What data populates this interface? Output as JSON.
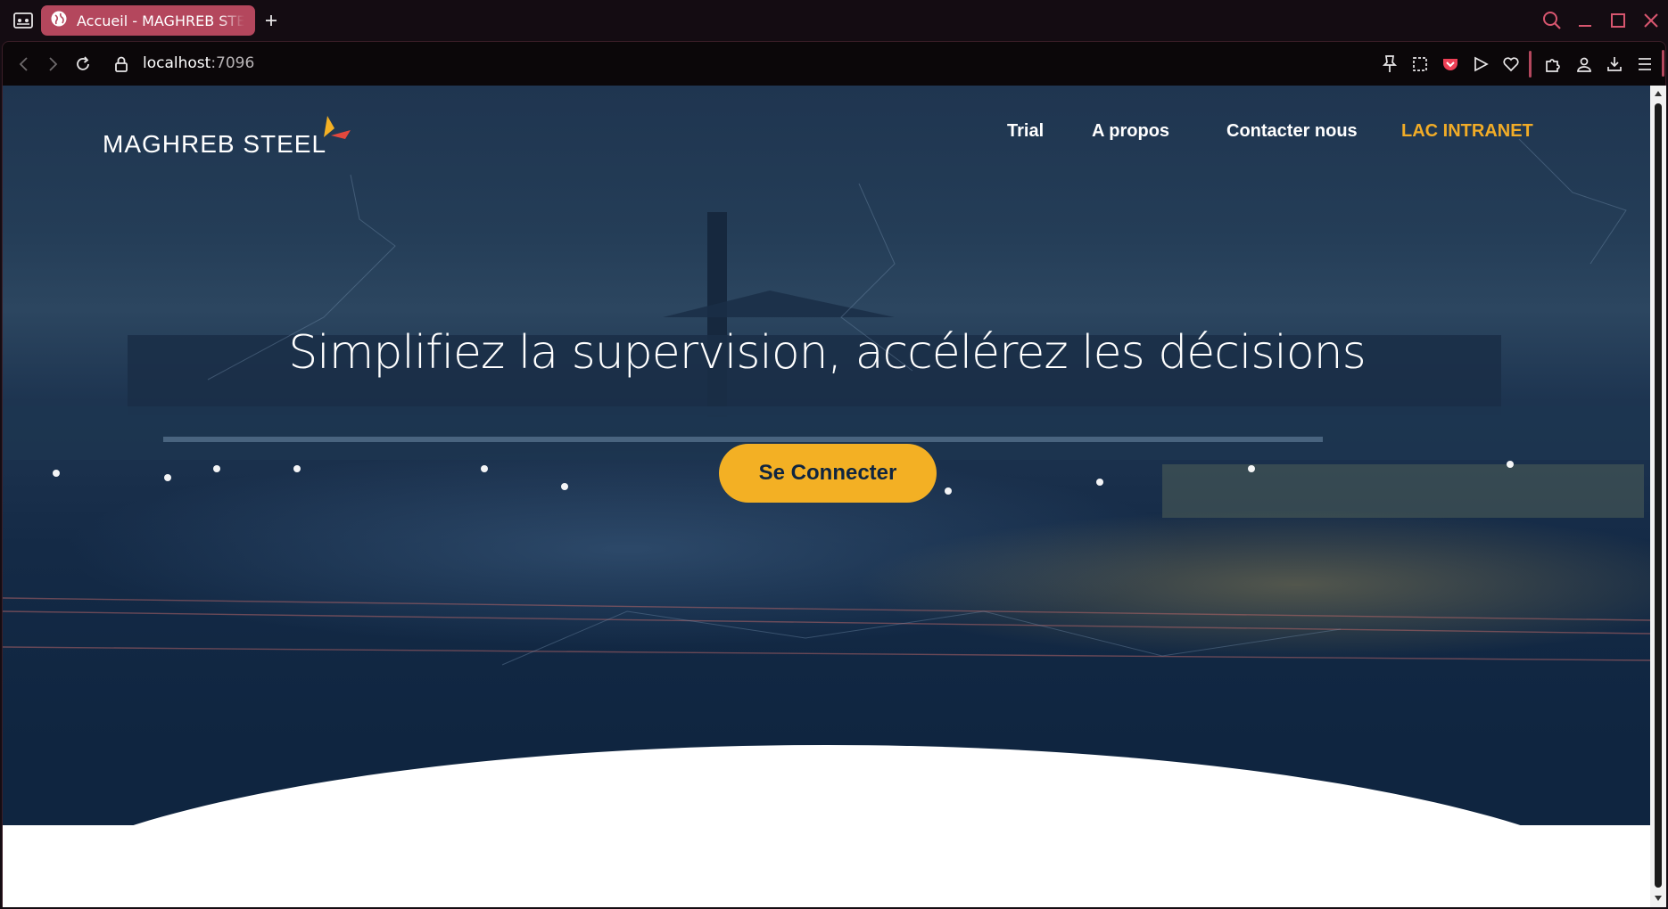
{
  "browser": {
    "tab_title": "Accueil - MAGHREB STEEL",
    "url_host": "localhost",
    "url_port": ":7096"
  },
  "colors": {
    "tab_active": "#b4475d",
    "hero_navy": "#0f2540",
    "accent_gold": "#f3b024",
    "nav_accent": "#f1ac27"
  },
  "icons": {
    "sidebar": "sidebar-toggle-icon",
    "tab_favicon": "globe-icon",
    "new_tab": "plus-icon",
    "search": "search-icon",
    "minimize": "minimize-icon",
    "maximize": "maximize-icon",
    "close": "close-icon",
    "back": "chevron-left-icon",
    "forward": "chevron-right-icon",
    "reload": "reload-icon",
    "lock": "lock-icon",
    "pin": "pin-icon",
    "screenshot": "screenshot-icon",
    "pocket": "pocket-icon",
    "send": "send-icon",
    "heart": "heart-icon",
    "extensions": "puzzle-icon",
    "profile": "profile-icon",
    "downloads": "download-icon",
    "menu": "menu-icon"
  },
  "site": {
    "logo_text": "MAGHREB STEEL",
    "nav": [
      "Trial",
      "A propos",
      "Contacter nous",
      "LAC INTRANET"
    ],
    "headline": "Simplifiez la supervision, accélérez les décisions",
    "cta_label": "Se Connecter"
  }
}
